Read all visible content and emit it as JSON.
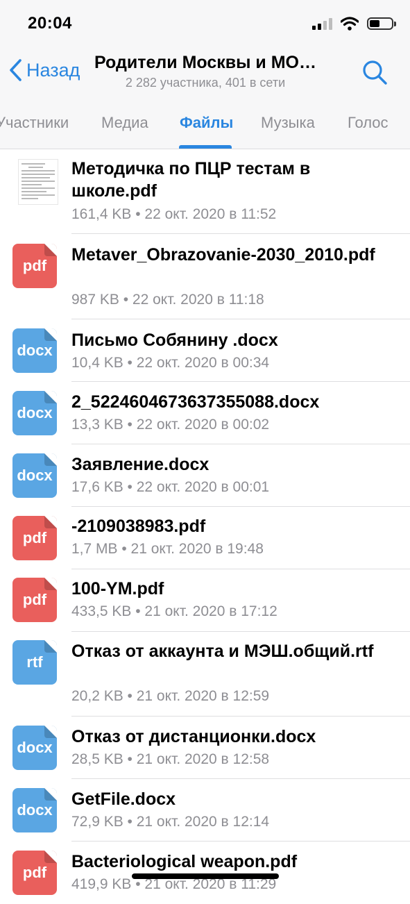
{
  "status_bar": {
    "time": "20:04"
  },
  "header": {
    "back_label": "Назад",
    "title": "Родители Москвы и МО…",
    "subtitle": "2 282 участника, 401 в сети"
  },
  "tabs": [
    {
      "label": "Участники"
    },
    {
      "label": "Медиа"
    },
    {
      "label": "Файлы",
      "active": true
    },
    {
      "label": "Музыка"
    },
    {
      "label": "Голос"
    }
  ],
  "colors": {
    "accent": "#2a86e0",
    "pdf": "#e95f5c",
    "docx": "#5aa6e3"
  },
  "files": [
    {
      "name": "Методичка по ПЦР тестам в школе.pdf",
      "meta": "161,4 KB • 22 окт. 2020 в 11:52",
      "type": "thumbnail",
      "icon": ""
    },
    {
      "name": "Metaver_Obrazovanie-2030_2010.pdf",
      "meta": "987 KB • 22 окт. 2020 в 11:18",
      "type": "pdf",
      "icon": "pdf"
    },
    {
      "name": "Письмо Собянину .docx",
      "meta": "10,4 KB • 22 окт. 2020 в 00:34",
      "type": "docx",
      "icon": "docx"
    },
    {
      "name": "2_5224604673637355088.docx",
      "meta": "13,3 KB • 22 окт. 2020 в 00:02",
      "type": "docx",
      "icon": "docx"
    },
    {
      "name": "Заявление.docx",
      "meta": "17,6 KB • 22 окт. 2020 в 00:01",
      "type": "docx",
      "icon": "docx"
    },
    {
      "name": "-2109038983.pdf",
      "meta": "1,7 MB • 21 окт. 2020 в 19:48",
      "type": "pdf",
      "icon": "pdf"
    },
    {
      "name": "100-YM.pdf",
      "meta": "433,5 KB • 21 окт. 2020 в 17:12",
      "type": "pdf",
      "icon": "pdf"
    },
    {
      "name": "Отказ от аккаунта и МЭШ.общий.rtf",
      "meta": "20,2 KB • 21 окт. 2020 в 12:59",
      "type": "rtf",
      "icon": "rtf"
    },
    {
      "name": "Отказ от дистанционки.docx",
      "meta": "28,5 KB • 21 окт. 2020 в 12:58",
      "type": "docx",
      "icon": "docx"
    },
    {
      "name": "GetFile.docx",
      "meta": "72,9 KB • 21 окт. 2020 в 12:14",
      "type": "docx",
      "icon": "docx"
    },
    {
      "name": "Bacteriological weapon.pdf",
      "meta": "419,9 KB • 21 окт. 2020 в 11:29",
      "type": "pdf",
      "icon": "pdf"
    }
  ]
}
